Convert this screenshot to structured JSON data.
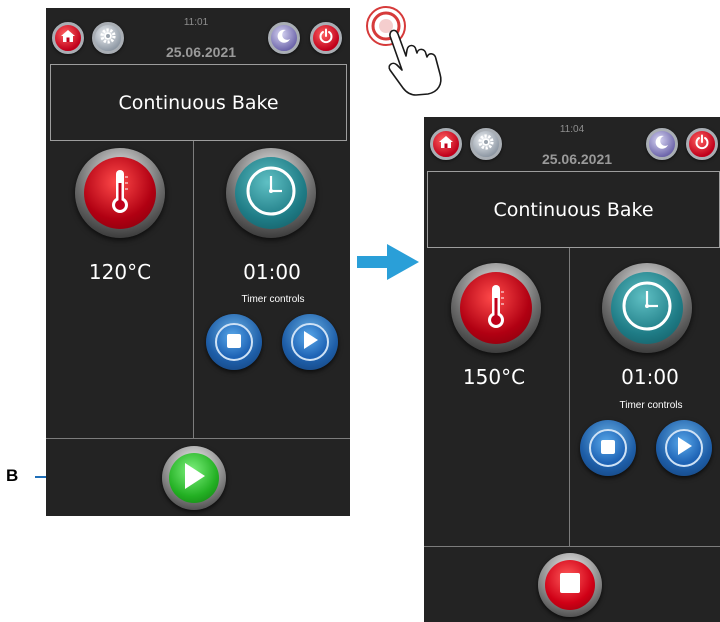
{
  "annotation": {
    "callout_letter": "B"
  },
  "screens": [
    {
      "id": "before",
      "time": "11:01",
      "date": "25.06.2021",
      "mode": "Continuous Bake",
      "temperature": "120°C",
      "timer": "01:00",
      "timer_controls_label": "Timer controls",
      "start_stop_state": "start"
    },
    {
      "id": "after",
      "time": "11:04",
      "date": "25.06.2021",
      "mode": "Continuous Bake",
      "temperature": "150°C",
      "timer": "01:00",
      "timer_controls_label": "Timer controls",
      "start_stop_state": "stop"
    }
  ],
  "icons": {
    "home": "home-icon",
    "settings": "gear-icon",
    "night_mode": "moon-icon",
    "power": "power-icon",
    "temperature": "thermometer-icon",
    "timer": "clock-icon",
    "timer_stop": "stop-icon",
    "timer_play": "play-icon",
    "start": "play-icon",
    "stop": "stop-icon",
    "transition": "arrow-right-icon",
    "touch_hint": "hand-tap-icon"
  },
  "colors": {
    "panel_bg": "#232323",
    "accent_red": "#c0001b",
    "accent_teal": "#1f7c86",
    "accent_blue": "#1e5ea8",
    "start_green": "#23b023",
    "arrow_blue": "#2a9fd8",
    "callout_blue": "#1f6fb8"
  }
}
